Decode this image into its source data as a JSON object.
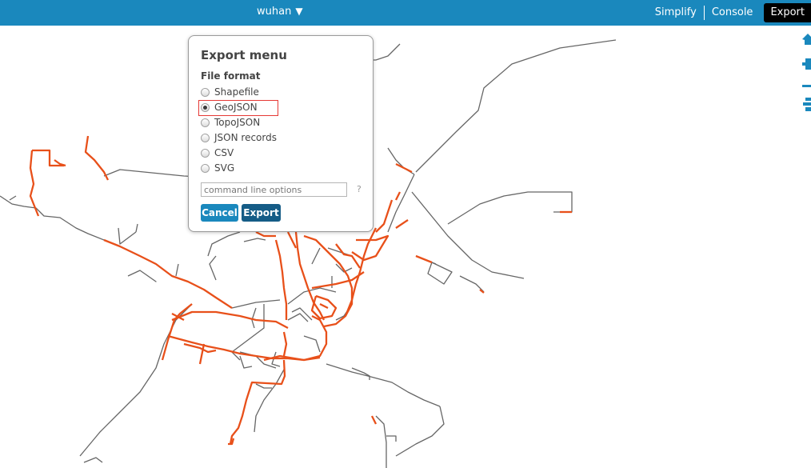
{
  "header": {
    "layer_name": "wuhan",
    "layer_caret": "▼",
    "nav": [
      "Simplify",
      "Console",
      "Export"
    ],
    "active_nav": "Export"
  },
  "tools": [
    "home-icon",
    "zoom-in-icon",
    "zoom-out-icon",
    "layers-icon"
  ],
  "export_dialog": {
    "title": "Export menu",
    "file_format_label": "File format",
    "options": [
      "Shapefile",
      "GeoJSON",
      "TopoJSON",
      "JSON records",
      "CSV",
      "SVG"
    ],
    "selected": "GeoJSON",
    "command_placeholder": "command line options",
    "command_value": "",
    "help": "?",
    "cancel_label": "Cancel",
    "export_label": "Export"
  },
  "colors": {
    "accent": "#1a88bd",
    "export_button": "#155c86",
    "active_tab": "#000000",
    "road_gray": "#666666",
    "road_highlight": "#e8501a",
    "selection_outline": "#e53935"
  }
}
